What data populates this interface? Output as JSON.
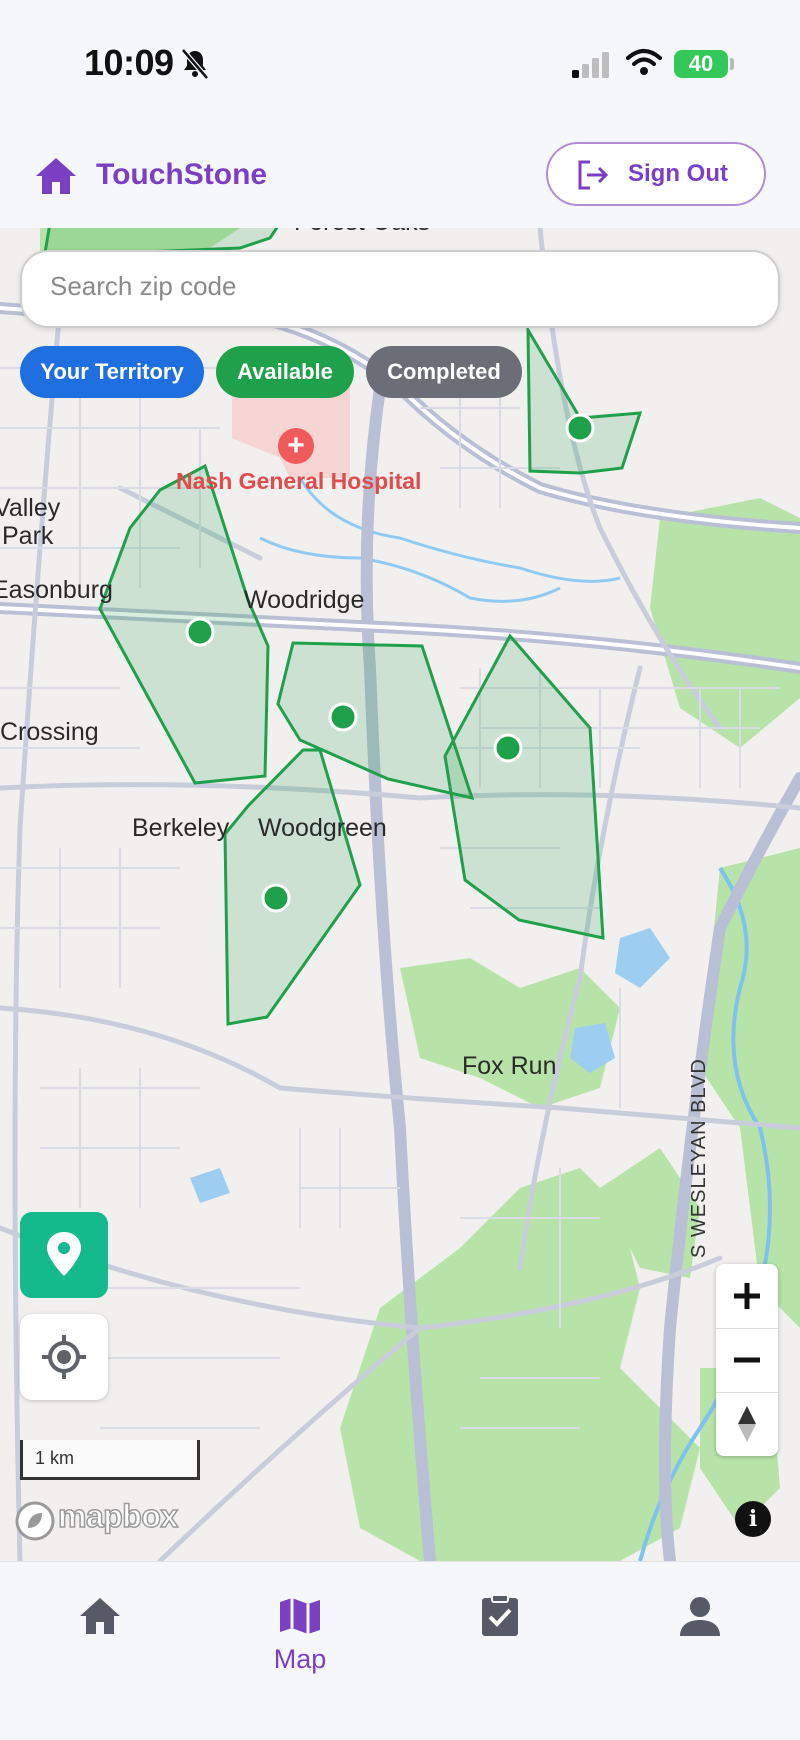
{
  "status_bar": {
    "time": "10:09",
    "battery": "40"
  },
  "header": {
    "brand": "TouchStone",
    "sign_out_label": "Sign Out"
  },
  "search": {
    "placeholder": "Search zip code"
  },
  "filters": [
    {
      "label": "Your Territory",
      "color": "#1f6fe0"
    },
    {
      "label": "Available",
      "color": "#1fa04a"
    },
    {
      "label": "Completed",
      "color": "#6b6e77"
    }
  ],
  "map": {
    "places": [
      "Forest Oaks",
      "Nash General Hospital",
      "Valley",
      "Park",
      "Easonburg",
      "Woodridge",
      "Crossing",
      "Berkeley",
      "Woodgreen",
      "Fox Run"
    ],
    "road": "S WESLEYAN BLVD",
    "scale_label": "1 km",
    "attribution": "mapbox",
    "info_glyph": "i",
    "territory_color": "#1fa04a"
  },
  "nav": {
    "items": [
      {
        "label": "",
        "icon": "home-icon"
      },
      {
        "label": "Map",
        "icon": "map-icon"
      },
      {
        "label": "",
        "icon": "clipboard-check-icon"
      },
      {
        "label": "",
        "icon": "person-icon"
      }
    ],
    "active_color": "#7b3fc4"
  }
}
